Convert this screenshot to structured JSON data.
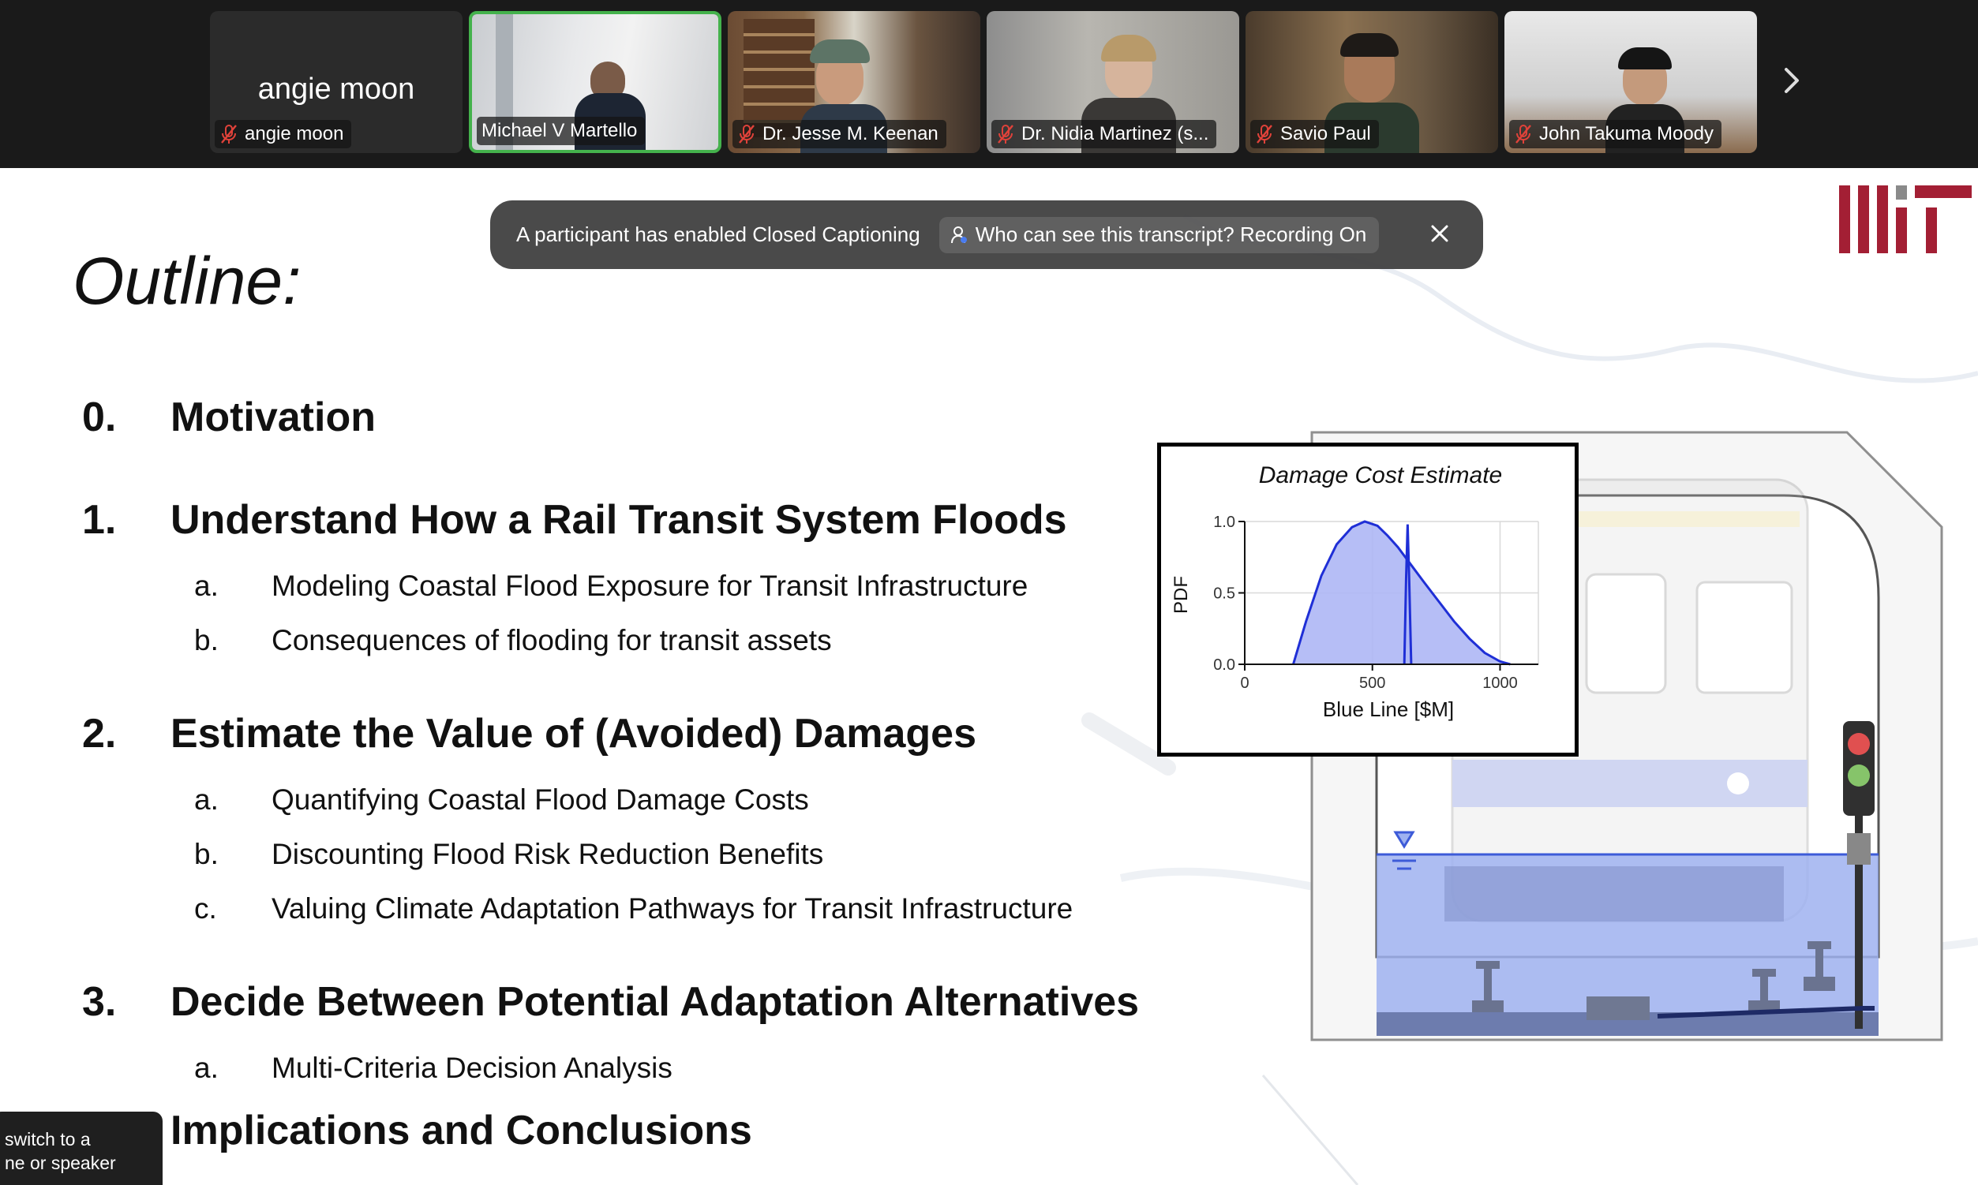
{
  "participants": [
    {
      "display_name": "angie moon",
      "name": "angie moon",
      "muted": true,
      "has_video": false
    },
    {
      "name": "Michael V Martello",
      "muted": false,
      "active_speaker": true
    },
    {
      "name": "Dr. Jesse M. Keenan",
      "muted": true
    },
    {
      "name": "Dr. Nidia Martinez (s...",
      "muted": true
    },
    {
      "name": "Savio Paul",
      "muted": true
    },
    {
      "name": "John Takuma Moody",
      "muted": true
    }
  ],
  "caption_banner": {
    "message": "A participant has enabled Closed Captioning",
    "pill_text": "Who can see this transcript? Recording On"
  },
  "tooltip": {
    "line1": "switch to a",
    "line2": "ne or speaker"
  },
  "slide": {
    "title": "Outline:",
    "sections": [
      {
        "num": "0.",
        "text": "Motivation",
        "subs": []
      },
      {
        "num": "1.",
        "text": "Understand How a Rail Transit System Floods",
        "subs": [
          {
            "letter": "a.",
            "text": "Modeling Coastal Flood Exposure for Transit Infrastructure"
          },
          {
            "letter": "b.",
            "text": "Consequences of flooding for transit assets"
          }
        ]
      },
      {
        "num": "2.",
        "text": "Estimate the Value of (Avoided) Damages",
        "subs": [
          {
            "letter": "a.",
            "text": "Quantifying Coastal Flood Damage Costs"
          },
          {
            "letter": "b.",
            "text": "Discounting Flood Risk Reduction Benefits"
          },
          {
            "letter": "c.",
            "text": "Valuing Climate Adaptation Pathways for Transit Infrastructure"
          }
        ]
      },
      {
        "num": "3.",
        "text": "Decide Between Potential Adaptation Alternatives",
        "subs": [
          {
            "letter": "a.",
            "text": "Multi-Criteria Decision Analysis"
          }
        ]
      },
      {
        "num": "",
        "text": "Implications and Conclusions",
        "subs": []
      }
    ],
    "logo": "MIT logo"
  },
  "chart_data": {
    "type": "area",
    "title": "Damage Cost Estimate",
    "xlabel": "Blue Line [$M]",
    "ylabel": "PDF",
    "xlim": [
      0,
      1150
    ],
    "ylim": [
      0,
      1.0
    ],
    "xticks": [
      "0",
      "500",
      "1000"
    ],
    "yticks": [
      "0.0",
      "0.5",
      "1.0"
    ],
    "series": [
      {
        "values": [
          [
            190,
            0
          ],
          [
            240,
            0.3
          ],
          [
            300,
            0.62
          ],
          [
            360,
            0.84
          ],
          [
            420,
            0.96
          ],
          [
            470,
            1.0
          ],
          [
            520,
            0.97
          ],
          [
            560,
            0.9
          ],
          [
            600,
            0.82
          ],
          [
            650,
            0.7
          ],
          [
            700,
            0.58
          ],
          [
            760,
            0.44
          ],
          [
            820,
            0.3
          ],
          [
            880,
            0.18
          ],
          [
            940,
            0.08
          ],
          [
            1000,
            0.02
          ],
          [
            1040,
            0
          ]
        ]
      },
      {
        "values": [
          [
            625,
            0
          ],
          [
            632,
            0.6
          ],
          [
            638,
            0.98
          ],
          [
            644,
            0.6
          ],
          [
            652,
            0
          ]
        ]
      }
    ],
    "fill_color": "#aeb7f5",
    "line_color": "#1f2fd6",
    "grid": true
  },
  "colors": {
    "strip_bg": "#1a1a1a",
    "active_border": "#44b24c",
    "muted_red": "#e0423a",
    "mit_red": "#a31f34",
    "water": "#9fb2f0"
  }
}
